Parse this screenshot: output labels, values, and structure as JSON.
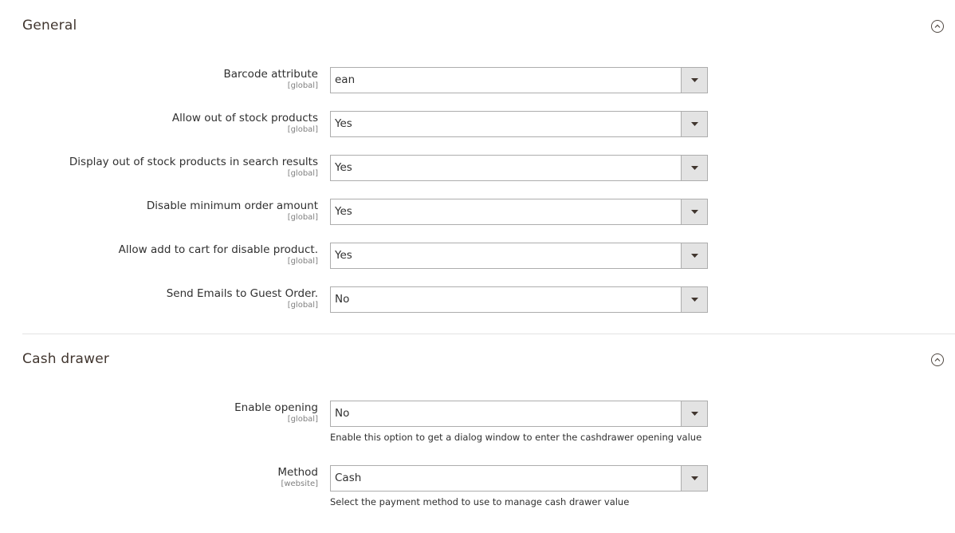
{
  "sections": [
    {
      "title": "General",
      "fields": [
        {
          "label": "Barcode attribute",
          "scope": "[global]",
          "value": "ean"
        },
        {
          "label": "Allow out of stock products",
          "scope": "[global]",
          "value": "Yes"
        },
        {
          "label": "Display out of stock products in search results",
          "scope": "[global]",
          "value": "Yes"
        },
        {
          "label": "Disable minimum order amount",
          "scope": "[global]",
          "value": "Yes"
        },
        {
          "label": "Allow add to cart for disable product.",
          "scope": "[global]",
          "value": "Yes"
        },
        {
          "label": "Send Emails to Guest Order.",
          "scope": "[global]",
          "value": "No"
        }
      ]
    },
    {
      "title": "Cash drawer",
      "fields": [
        {
          "label": "Enable opening",
          "scope": "[global]",
          "value": "No",
          "note": "Enable this option to get a dialog window to enter the cashdrawer opening value"
        },
        {
          "label": "Method",
          "scope": "[website]",
          "value": "Cash",
          "note": "Select the payment method to use to manage cash drawer value"
        }
      ]
    }
  ],
  "icons": {
    "collapse": "chevron-up-circle-icon",
    "dropdown": "caret-down-icon"
  },
  "colors": {
    "text": "#303030",
    "scope": "#808080",
    "border": "#adadad",
    "arrow_bg": "#e3e3e3"
  }
}
